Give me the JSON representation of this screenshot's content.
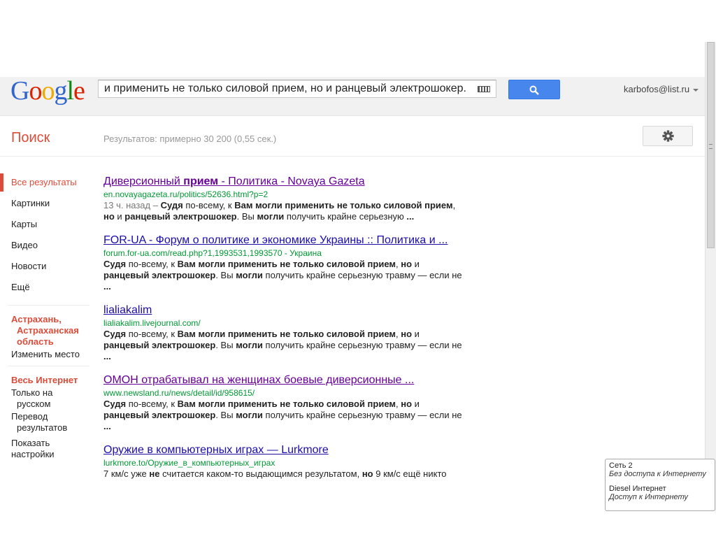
{
  "header": {
    "logo": [
      "G",
      "o",
      "o",
      "g",
      "l",
      "e"
    ],
    "search_query": "и применить не только силовой прием, но и ранцевый электрошокер.",
    "account": "karbofos@list.ru"
  },
  "toolbar": {
    "title": "Поиск",
    "stats": "Результатов: примерно 30 200 (0,55 сек.)"
  },
  "sidebar": {
    "items": [
      "Все результаты",
      "Картинки",
      "Карты",
      "Видео",
      "Новости",
      "Ещё"
    ],
    "location": [
      "Астрахань,",
      "Астраханская",
      "область"
    ],
    "change_location": "Изменить место",
    "web_head": "Весь Интернет",
    "only_russian": [
      "Только на",
      "русском"
    ],
    "translate": [
      "Перевод",
      "результатов"
    ],
    "show_settings": [
      "Показать",
      "настройки"
    ]
  },
  "results": [
    {
      "title_parts": [
        "Диверсионный ",
        "прием",
        " - Политика - Novaya Gazeta"
      ],
      "url": "en.novayagazeta.ru/politics/52636.html?p=2",
      "snippet": [
        "13 ч. назад – ",
        "Судя",
        " по-всему, к ",
        "Вам могли применить не только силовой прием",
        ", ",
        "но",
        " и ",
        "ранцевый электрошокер",
        ". Вы ",
        "могли",
        " получить крайне серьезную ",
        "..."
      ]
    },
    {
      "title": "FOR-UA - Форум о политике и экономике Украины :: Политика и ...",
      "url": "forum.for-ua.com/read.php?1,1993531,1993570 - Украина",
      "snippet": [
        "Судя",
        " по-всему, к ",
        "Вам могли применить не только силовой прием",
        ", ",
        "но",
        " и ",
        "ранцевый электрошокер",
        ". Вы ",
        "могли",
        " получить крайне серьезную травму — если не ",
        "..."
      ]
    },
    {
      "title": "lialiakalim",
      "url": "lialiakalim.livejournal.com/",
      "snippet": [
        "Судя",
        " по-всему, к ",
        "Вам могли применить не только силовой прием",
        ", ",
        "но",
        " и ",
        "ранцевый электрошокер",
        ". Вы ",
        "могли",
        " получить крайне серьезную травму — если не ",
        "..."
      ]
    },
    {
      "title": "ОМОН отрабатывал на женщинах боевые диверсионные ...",
      "url": "www.newsland.ru/news/detail/id/958615/",
      "snippet": [
        "Судя",
        " по-всему, к ",
        "Вам могли применить не только силовой прием",
        ", ",
        "но",
        " и ",
        "ранцевый электрошокер",
        ". Вы ",
        "могли",
        " получить крайне серьезную травму — если не ",
        "..."
      ]
    },
    {
      "title": "Оружие в компьютерных играх — Lurkmore",
      "url": "lurkmore.to/Оружие_в_компьютерных_играх",
      "snippet": [
        "7 км/с уже ",
        "не",
        " считается каком-то выдающимся результатом, ",
        "но",
        " 9 км/с ещё никто"
      ]
    }
  ],
  "network_popup": {
    "net2_name": "Сеть  2",
    "net2_status": "Без доступа к Интернету",
    "diesel_name": "Diesel Интернет",
    "diesel_status": "Доступ к Интернету"
  },
  "colors": {
    "accent_red": "#dd4b39",
    "link_blue": "#1a0dab",
    "link_visited": "#660099",
    "url_green": "#009933",
    "search_button": "#4787ed"
  }
}
